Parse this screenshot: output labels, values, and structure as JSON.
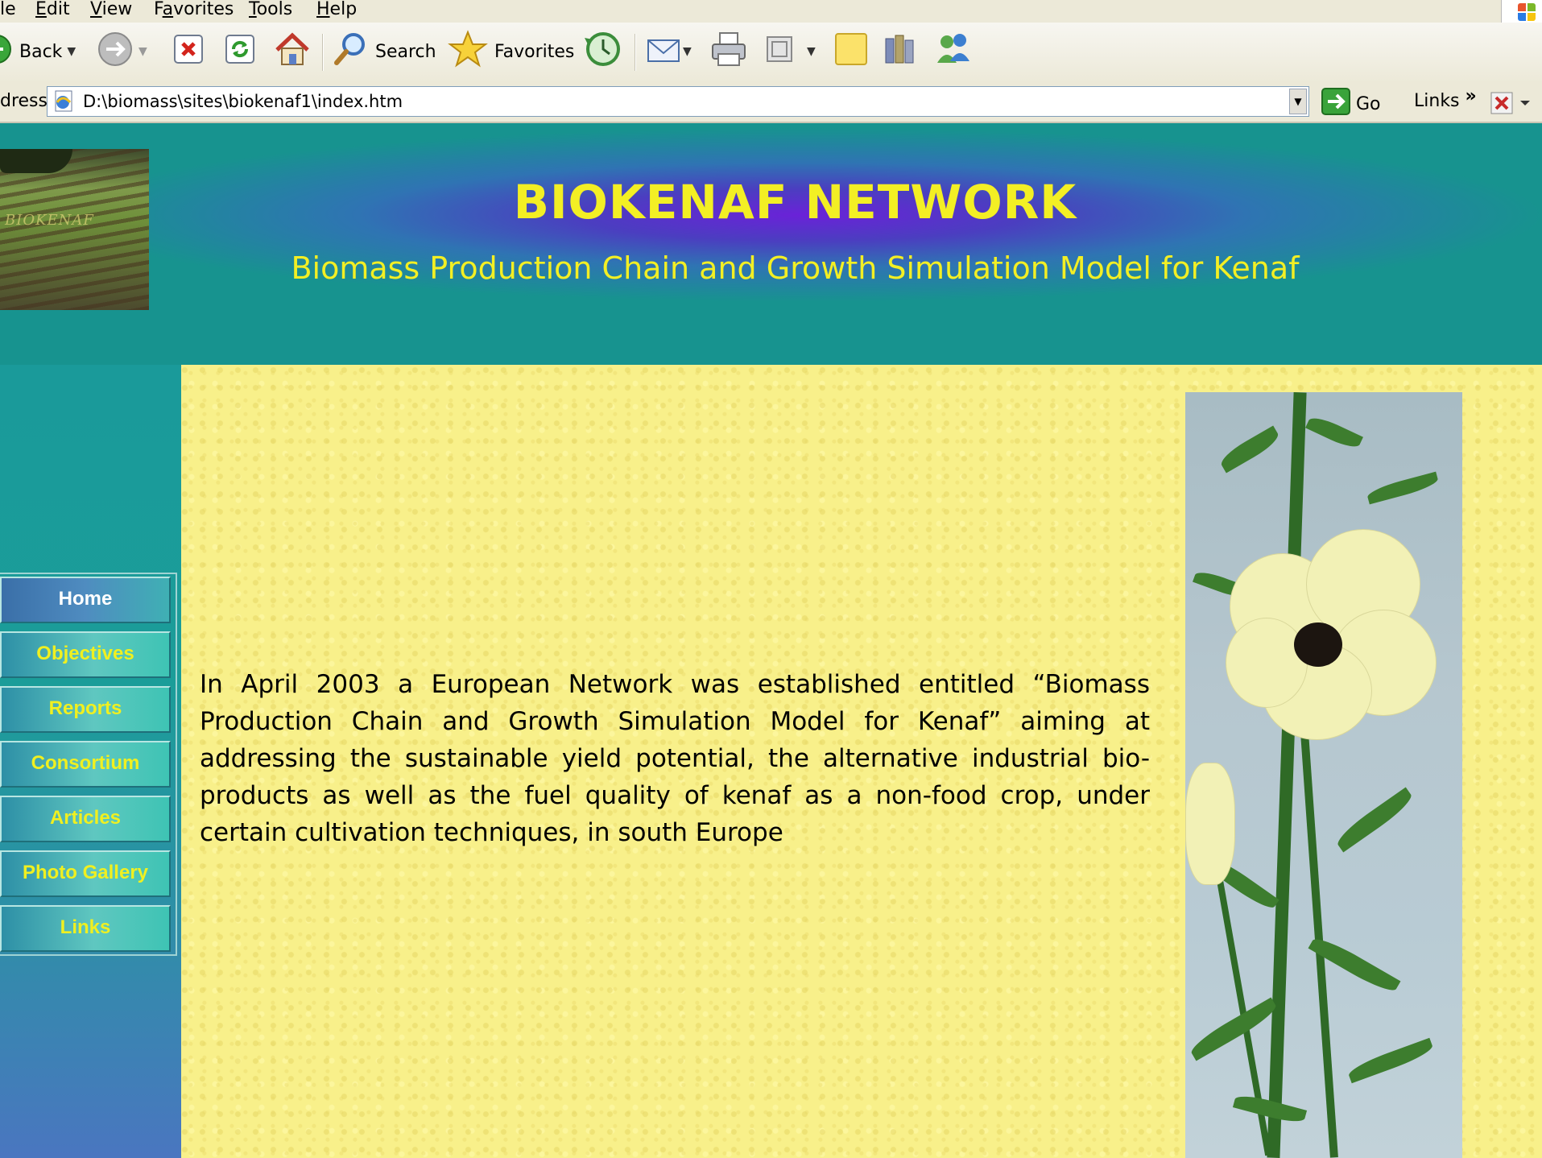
{
  "menubar": {
    "items": [
      {
        "pre": "",
        "accel": "",
        "post": "le"
      },
      {
        "pre": "",
        "accel": "E",
        "post": "dit"
      },
      {
        "pre": "",
        "accel": "V",
        "post": "iew"
      },
      {
        "pre": "F",
        "accel": "a",
        "post": "vorites"
      },
      {
        "pre": "",
        "accel": "T",
        "post": "ools"
      },
      {
        "pre": "",
        "accel": "H",
        "post": "elp"
      }
    ]
  },
  "toolbar": {
    "back_label": "Back",
    "search_label": "Search",
    "favorites_label": "Favorites"
  },
  "addressbar": {
    "label": "dress",
    "url": "D:\\biomass\\sites\\biokenaf1\\index.htm",
    "go_label": "Go",
    "links_label": "Links",
    "links_chevron": "»"
  },
  "banner": {
    "title": "BIOKENAF NETWORK",
    "subtitle": "Biomass Production Chain and Growth Simulation Model for Kenaf",
    "photo_watermark": "BIOKENAF"
  },
  "nav": {
    "items": [
      "Home",
      "Objectives",
      "Reports",
      "Consortium",
      "Articles",
      "Photo Gallery",
      "Links"
    ]
  },
  "content": {
    "intro": "In April 2003 a European Network was established entitled “Biomass Production Chain and Growth Simulation Model for Kenaf” aiming at addressing the sustainable yield potential, the alternative industrial bio-products as well as the fuel quality of kenaf as a non-food crop, under certain cultivation techniques, in south Europe"
  },
  "colors": {
    "title_yellow": "#f3ef24",
    "content_bg": "#f8f08a",
    "sidebar_teal": "#1a9a9a"
  }
}
